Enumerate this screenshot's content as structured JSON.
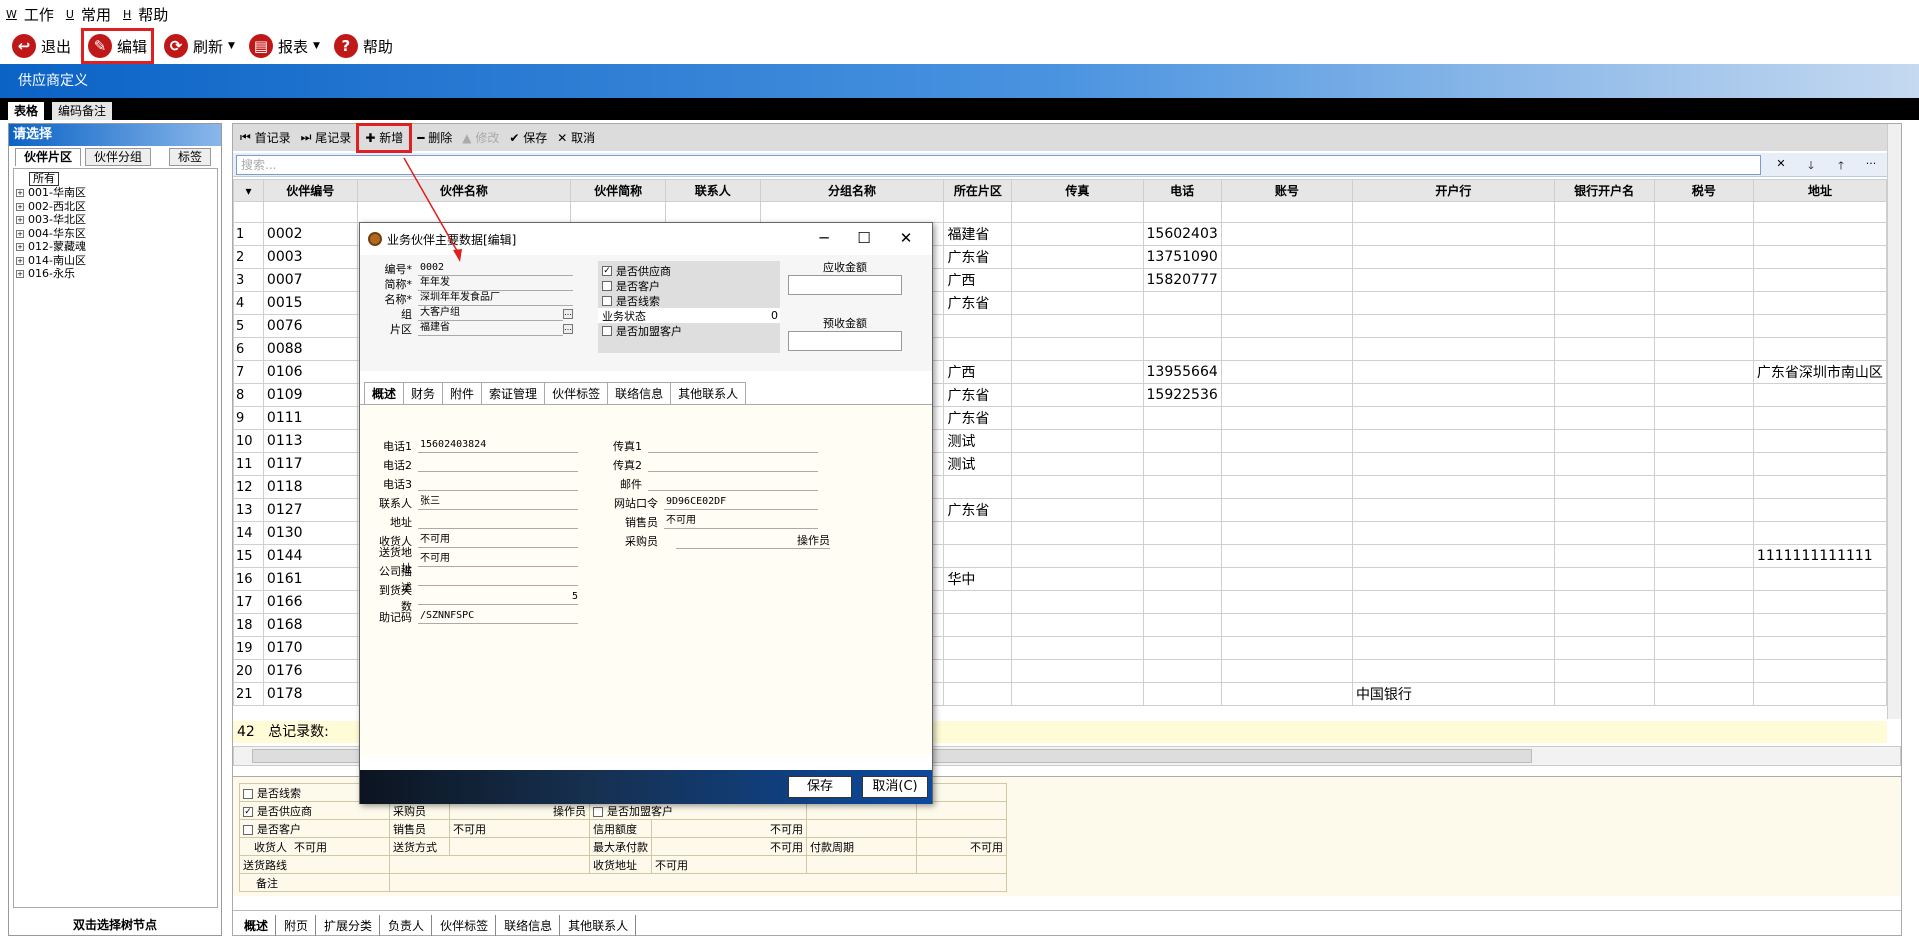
{
  "menu": [
    {
      "key": "W",
      "label": "工作"
    },
    {
      "key": "U",
      "label": "常用"
    },
    {
      "key": "H",
      "label": "帮助"
    }
  ],
  "toolbar": {
    "exit": "退出",
    "edit": "编辑",
    "refresh": "刷新",
    "report": "报表",
    "help": "帮助"
  },
  "window_title": "供应商定义",
  "main_tabs": [
    "表格",
    "编码备注"
  ],
  "left": {
    "header": "请选择",
    "tabs": [
      "伙伴片区",
      "伙伴分组",
      "标签"
    ],
    "root": "所有",
    "nodes": [
      "001-华南区",
      "002-西北区",
      "003-华北区",
      "004-华东区",
      "012-蒙藏魂",
      "014-南山区",
      "016-永乐"
    ],
    "footer": "双击选择树节点"
  },
  "grid_toolbar": {
    "first": "首记录",
    "last": "尾记录",
    "add": "新增",
    "delete": "删除",
    "modify": "修改",
    "save": "保存",
    "cancel": "取消"
  },
  "search_placeholder": "搜索...",
  "columns": [
    "伙伴编号",
    "伙伴名称",
    "伙伴简称",
    "联系人",
    "分组名称",
    "所在片区",
    "传真",
    "电话",
    "账号",
    "开户行",
    "银行开户名",
    "税号",
    "地址"
  ],
  "rows": [
    {
      "n": "1",
      "code": "0002",
      "region": "福建省",
      "tel": "15602403",
      "bank": "",
      "addr": ""
    },
    {
      "n": "2",
      "code": "0003",
      "region": "广东省",
      "tel": "13751090",
      "bank": "",
      "addr": ""
    },
    {
      "n": "3",
      "code": "0007",
      "region": "广西",
      "tel": "15820777",
      "bank": "",
      "addr": ""
    },
    {
      "n": "4",
      "code": "0015",
      "region": "广东省",
      "tel": "",
      "bank": "",
      "addr": ""
    },
    {
      "n": "5",
      "code": "0076",
      "region": "",
      "tel": "",
      "bank": "",
      "addr": ""
    },
    {
      "n": "6",
      "code": "0088",
      "region": "",
      "tel": "",
      "bank": "",
      "addr": ""
    },
    {
      "n": "7",
      "code": "0106",
      "region": "广西",
      "tel": "13955664",
      "bank": "",
      "addr": "广东省深圳市南山区"
    },
    {
      "n": "8",
      "code": "0109",
      "region": "广东省",
      "tel": "15922536",
      "bank": "",
      "addr": ""
    },
    {
      "n": "9",
      "code": "0111",
      "region": "广东省",
      "tel": "",
      "bank": "",
      "addr": ""
    },
    {
      "n": "10",
      "code": "0113",
      "region": "测试",
      "tel": "",
      "bank": "",
      "addr": ""
    },
    {
      "n": "11",
      "code": "0117",
      "region": "测试",
      "tel": "",
      "bank": "",
      "addr": ""
    },
    {
      "n": "12",
      "code": "0118",
      "region": "",
      "tel": "",
      "bank": "",
      "addr": ""
    },
    {
      "n": "13",
      "code": "0127",
      "region": "广东省",
      "tel": "",
      "bank": "",
      "addr": ""
    },
    {
      "n": "14",
      "code": "0130",
      "region": "",
      "tel": "",
      "bank": "",
      "addr": ""
    },
    {
      "n": "15",
      "code": "0144",
      "region": "",
      "tel": "",
      "bank": "",
      "addr": "1111111111111"
    },
    {
      "n": "16",
      "code": "0161",
      "region": "华中",
      "tel": "",
      "bank": "",
      "addr": ""
    },
    {
      "n": "17",
      "code": "0166",
      "region": "",
      "tel": "",
      "bank": "",
      "addr": ""
    },
    {
      "n": "18",
      "code": "0168",
      "region": "",
      "tel": "",
      "bank": "",
      "addr": ""
    },
    {
      "n": "19",
      "code": "0170",
      "region": "",
      "tel": "",
      "bank": "",
      "addr": ""
    },
    {
      "n": "20",
      "code": "0176",
      "region": "",
      "tel": "",
      "bank": "",
      "addr": ""
    },
    {
      "n": "21",
      "code": "0178",
      "region": "",
      "tel": "",
      "bank": "中国银行",
      "addr": ""
    }
  ],
  "count": {
    "total": "42",
    "label": "总记录数:"
  },
  "detail": {
    "is_lead": "是否线索",
    "is_supplier": "是否供应商",
    "is_customer": "是否客户",
    "is_franchise": "是否加盟客户",
    "buyer": "采购员",
    "operator": "操作员",
    "seller": "销售员",
    "credit": "信用额度",
    "unavailable": "不可用",
    "receiver": "收货人",
    "ship_method": "送货方式",
    "max_credit": "最大承付款",
    "pay_period": "付款周期",
    "route": "送货路线",
    "ship_addr": "收货地址",
    "note": "备注"
  },
  "bottom_tabs": [
    "概述",
    "附页",
    "扩展分类",
    "负责人",
    "伙伴标签",
    "联络信息",
    "其他联系人"
  ],
  "dialog": {
    "title": "业务伙伴主要数据[编辑]",
    "code_l": "编号*",
    "code": "0002",
    "short_l": "简称*",
    "short": "年年发",
    "name_l": "名称*",
    "name": "深圳年年发食品厂",
    "group_l": "组",
    "group": "大客户组",
    "region_l": "片区",
    "region": "福建省",
    "chk_supplier": "是否供应商",
    "chk_customer": "是否客户",
    "chk_lead": "是否线索",
    "biz_state_l": "业务状态",
    "biz_state": "0",
    "chk_franchise": "是否加盟客户",
    "recv_amt": "应收金额",
    "prepay_amt": "预收金额",
    "tabs": [
      "概述",
      "财务",
      "附件",
      "索证管理",
      "伙伴标签",
      "联络信息",
      "其他联系人"
    ],
    "tel1_l": "电话1",
    "tel1": "15602403824",
    "tel2_l": "电话2",
    "tel3_l": "电话3",
    "contact_l": "联系人",
    "contact": "张三",
    "addr_l": "地址",
    "recv_l": "收货人",
    "recv": "不可用",
    "ship_l": "送货地址",
    "ship": "不可用",
    "desc_l": "公司描述",
    "days_l": "到货天数",
    "days": "5",
    "memo_l": "助记码",
    "memo": "/SZNNFSPC",
    "fax1_l": "传真1",
    "fax2_l": "传真2",
    "mail_l": "邮件",
    "pwd_l": "网站口令",
    "pwd": "9D96CE02DF",
    "seller_l": "销售员",
    "seller": "不可用",
    "buyer_l": "采购员",
    "operator_l": "操作员",
    "save": "保存",
    "cancel": "取消(C)"
  }
}
